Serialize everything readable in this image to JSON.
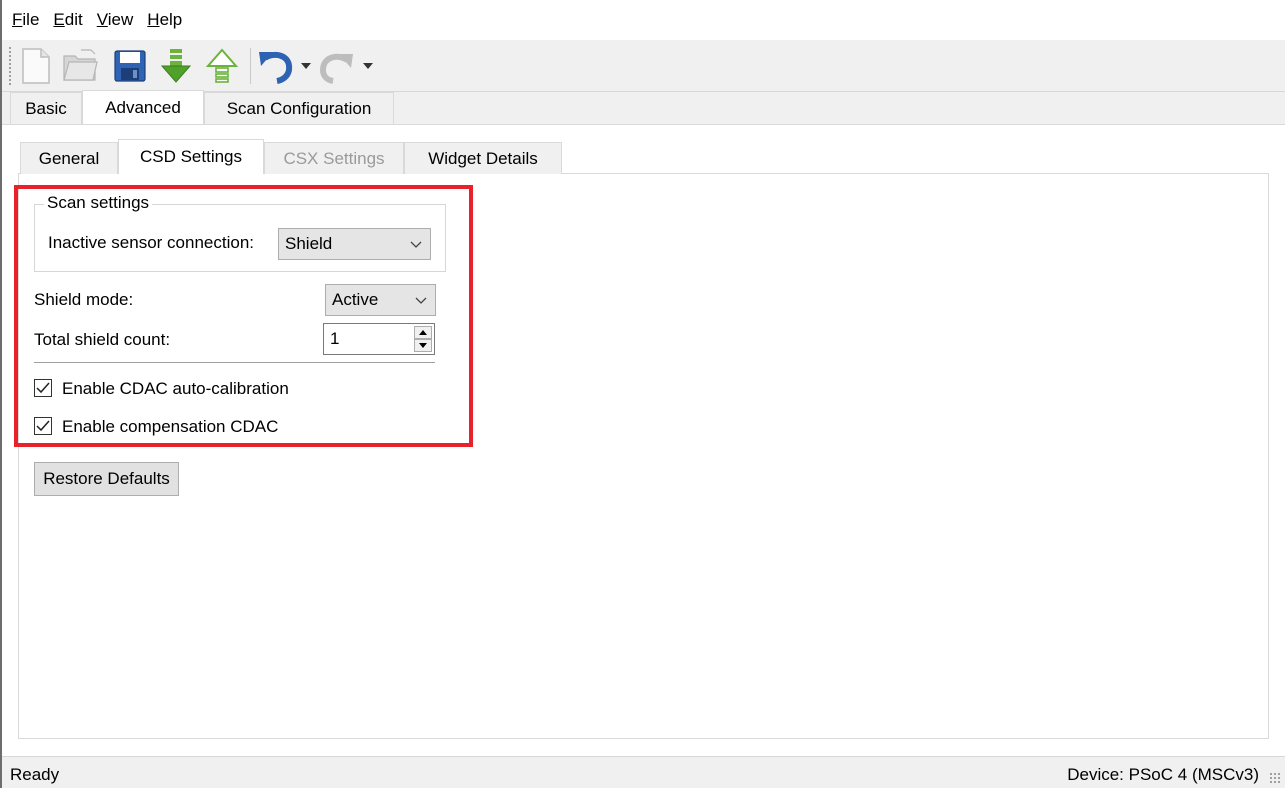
{
  "menu": {
    "items": [
      {
        "accel": "F",
        "rest": "ile"
      },
      {
        "accel": "E",
        "rest": "dit"
      },
      {
        "accel": "V",
        "rest": "iew"
      },
      {
        "accel": "H",
        "rest": "elp"
      }
    ]
  },
  "toolbar": {
    "icons": [
      "new-file-icon",
      "open-folder-icon",
      "save-icon",
      "import-arrow-down-icon",
      "export-arrow-up-icon",
      "undo-icon",
      "dropdown-arrow-icon",
      "redo-icon",
      "dropdown-arrow-icon"
    ]
  },
  "outer_tabs": [
    "Basic",
    "Advanced",
    "Scan Configuration"
  ],
  "inner_tabs": [
    "General",
    "CSD Settings",
    "CSX Settings",
    "Widget Details"
  ],
  "scan_settings": {
    "title": "Scan settings",
    "inactive_label": "Inactive sensor connection:",
    "inactive_value": "Shield"
  },
  "shield": {
    "mode_label": "Shield mode:",
    "mode_value": "Active",
    "count_label": "Total shield count:",
    "count_value": "1"
  },
  "checks": {
    "auto_cal_label": "Enable CDAC auto-calibration",
    "auto_cal_checked": true,
    "comp_label": "Enable compensation CDAC",
    "comp_checked": true
  },
  "restore_label": "Restore Defaults",
  "status": {
    "left": "Ready",
    "right": "Device: PSoC 4 (MSCv3)"
  },
  "colors": {
    "highlight": "#e8212b"
  }
}
